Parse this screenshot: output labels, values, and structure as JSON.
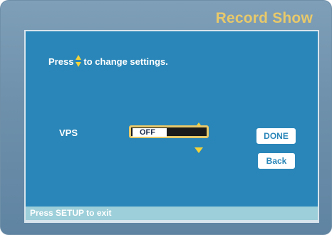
{
  "header": {
    "title": "Record Show"
  },
  "instruction": {
    "prefix": "Press",
    "suffix": "to change settings.",
    "icon": "up-down-arrows-icon"
  },
  "setting": {
    "label": "VPS",
    "value": "OFF",
    "icons": [
      "arrow-up-icon",
      "arrow-down-icon"
    ]
  },
  "buttons": {
    "done_label": "DONE",
    "back_label": "Back"
  },
  "status": {
    "text": "Press SETUP to exit"
  },
  "colors": {
    "title": "#e8c96a",
    "panel": "#2a86b8",
    "frame": "#7393ad",
    "status_bar": "#9ccfd9",
    "focus_border": "#e8c96a"
  }
}
